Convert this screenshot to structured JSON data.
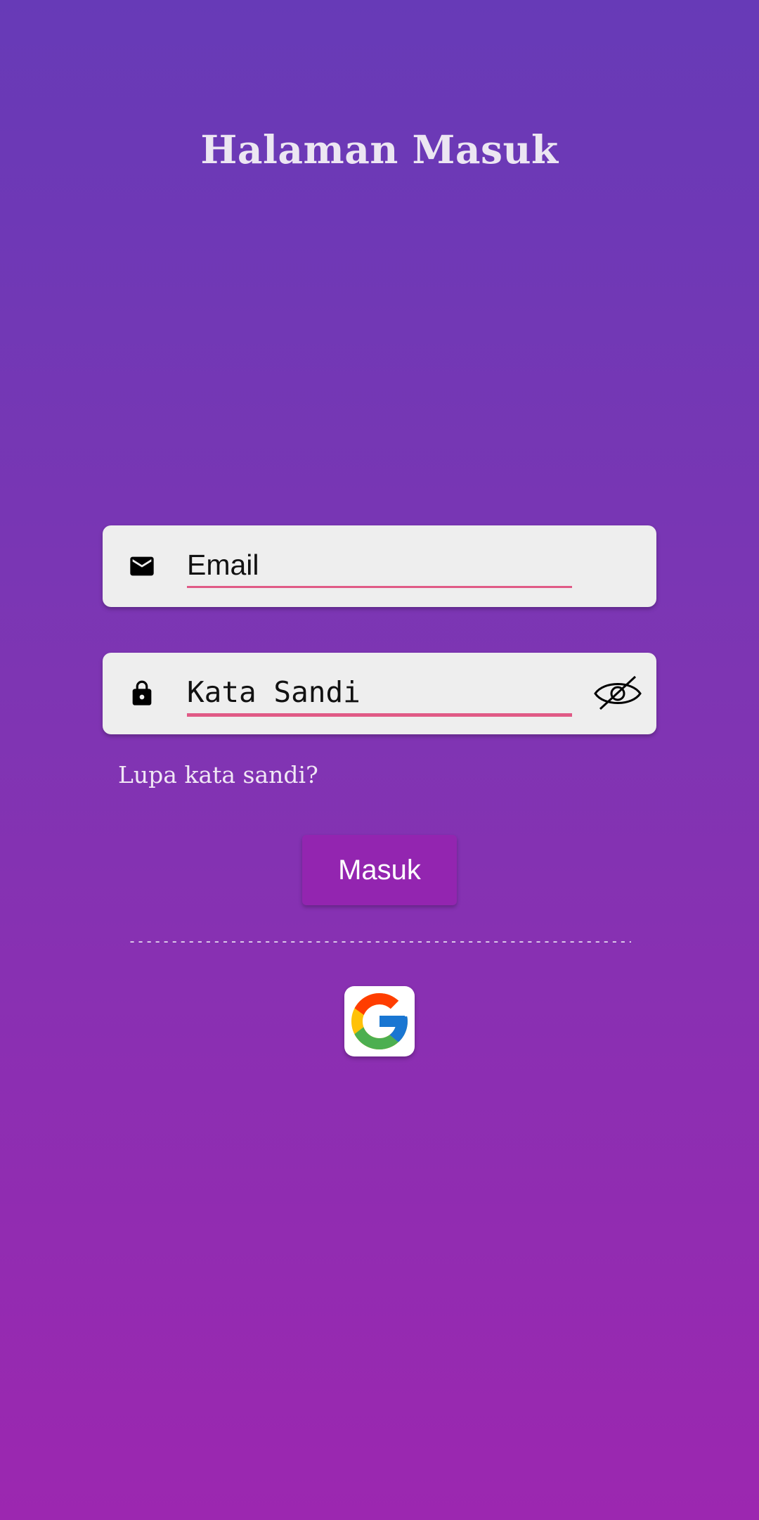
{
  "header": {
    "title": "Halaman Masuk"
  },
  "form": {
    "email": {
      "placeholder": "Email",
      "value": "",
      "icon": "mail-icon"
    },
    "password": {
      "placeholder": "Kata Sandi",
      "value": "",
      "icon": "lock-icon",
      "toggle_icon": "eye-off-icon"
    },
    "forgot_label": "Lupa kata sandi?",
    "submit_label": "Masuk",
    "divider_text": "------------------------------------------------------------------------"
  },
  "social": {
    "google_icon": "google-icon"
  },
  "colors": {
    "gradient_top": "#673ab7",
    "gradient_bottom": "#9c27b0",
    "field_bg": "#eeeeee",
    "underline": "#e05a86",
    "button_bg": "#9325b0"
  }
}
